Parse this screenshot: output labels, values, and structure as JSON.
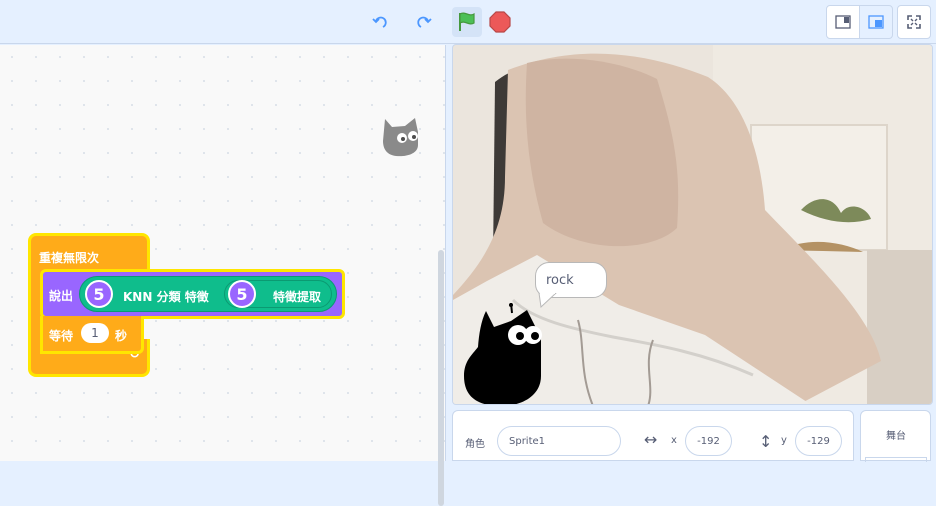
{
  "toolbar": {
    "undo_icon": "undo-icon",
    "redo_icon": "redo-icon",
    "green_flag_icon": "green-flag-icon",
    "stop_icon": "stop-icon",
    "small_stage_icon": "small-stage-icon",
    "large_stage_icon": "large-stage-icon",
    "fullscreen_icon": "fullscreen-icon"
  },
  "code": {
    "forever_label": "重複無限次",
    "say_label": "說出",
    "knn_number": "5",
    "knn_label": "KNN 分類 特徵",
    "feature_number": "5",
    "feature_label": "特徵提取",
    "wait_label": "等待",
    "wait_value": "1",
    "wait_unit": "秒"
  },
  "stage": {
    "speech_bubble": "rock"
  },
  "sprite_info": {
    "sprite_label": "角色",
    "sprite_name": "Sprite1",
    "x_label": "x",
    "x_value": "-192",
    "y_label": "y",
    "y_value": "-129"
  },
  "stage_panel": {
    "label": "舞台"
  },
  "colors": {
    "control": "#ffab19",
    "looks": "#9966ff",
    "extension": "#0fbd8c",
    "highlight": "#ffe600",
    "ui_blue": "#4c97ff"
  }
}
